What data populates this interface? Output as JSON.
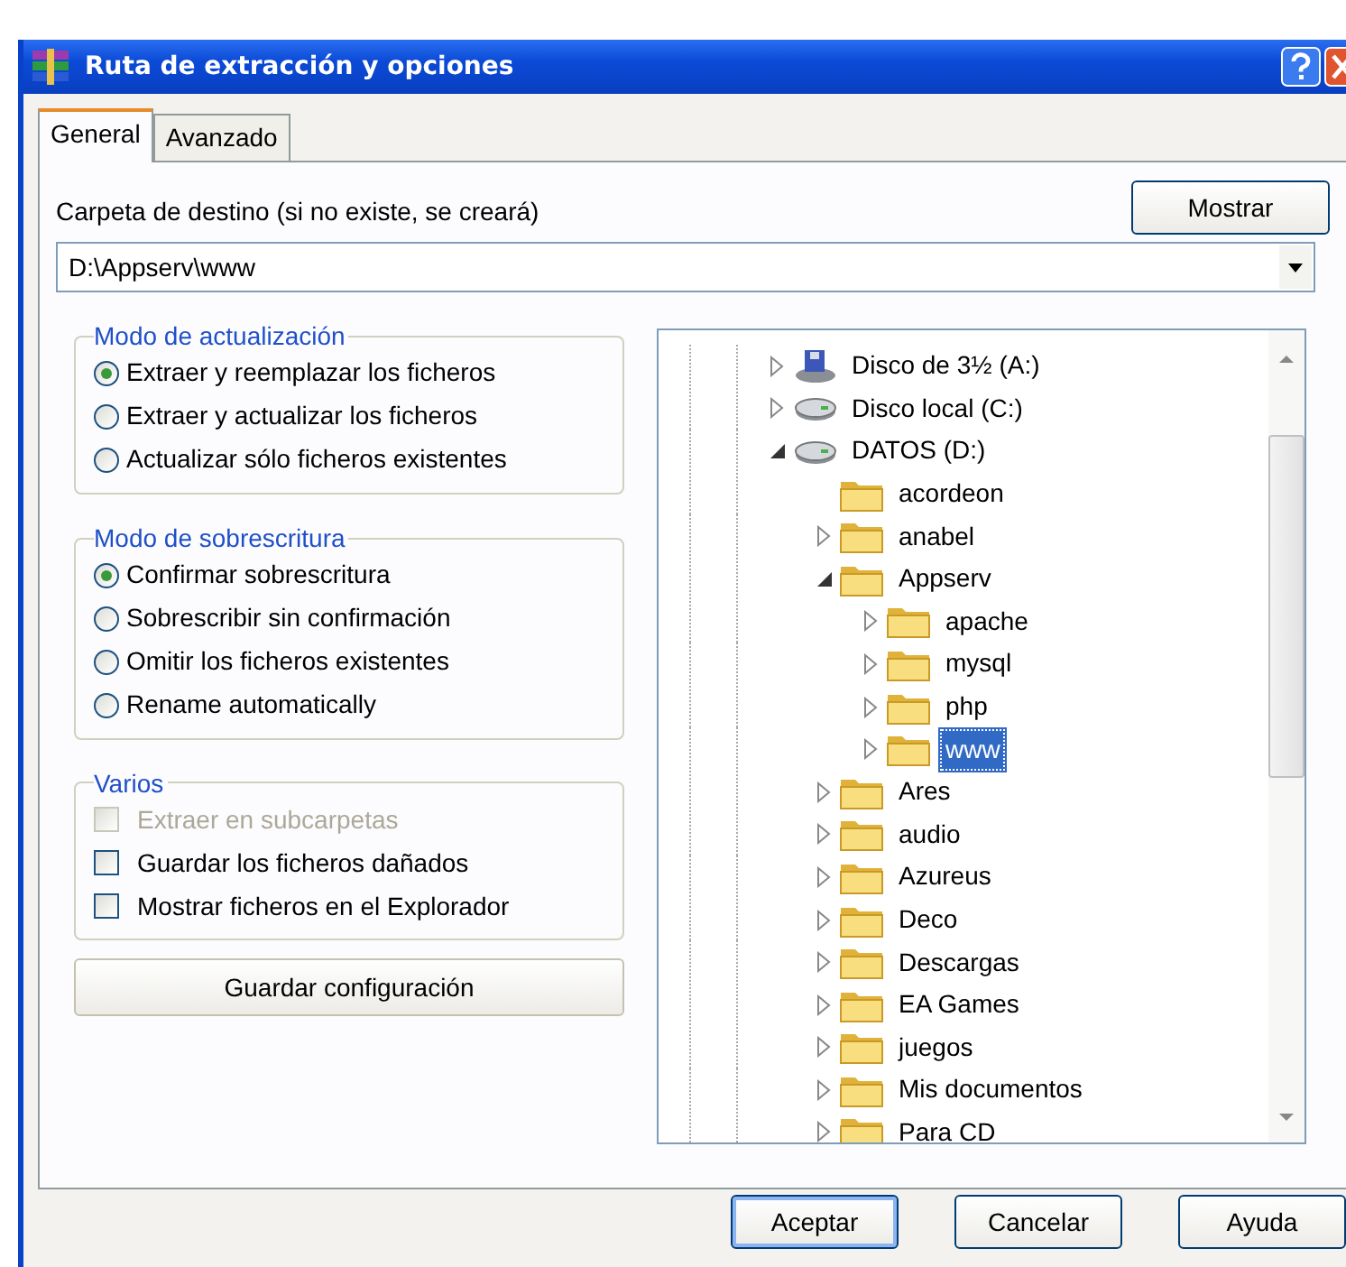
{
  "window": {
    "title": "Ruta de extracción y opciones"
  },
  "tabs": [
    {
      "label": "General",
      "selected": true
    },
    {
      "label": "Avanzado",
      "selected": false
    }
  ],
  "destination": {
    "label": "Carpeta de destino (si no existe, se creará)",
    "button": "Mostrar",
    "value": "D:\\Appserv\\www"
  },
  "update_mode": {
    "title": "Modo de actualización",
    "options": [
      {
        "label": "Extraer y reemplazar los ficheros",
        "selected": true
      },
      {
        "label": "Extraer y actualizar los ficheros",
        "selected": false
      },
      {
        "label": "Actualizar sólo ficheros existentes",
        "selected": false
      }
    ]
  },
  "overwrite_mode": {
    "title": "Modo de sobrescritura",
    "options": [
      {
        "label": "Confirmar sobrescritura",
        "selected": true
      },
      {
        "label": "Sobrescribir sin confirmación",
        "selected": false
      },
      {
        "label": "Omitir los ficheros existentes",
        "selected": false
      },
      {
        "label": "Rename automatically",
        "selected": false
      }
    ]
  },
  "misc": {
    "title": "Varios",
    "options": [
      {
        "label": "Extraer en subcarpetas",
        "checked": false,
        "disabled": true
      },
      {
        "label": "Guardar los ficheros dañados",
        "checked": false,
        "disabled": false
      },
      {
        "label": "Mostrar ficheros en el Explorador",
        "checked": false,
        "disabled": false
      }
    ]
  },
  "save_button": "Guardar configuración",
  "tree": [
    {
      "label": "Disco de 3½ (A:)",
      "kind": "floppy",
      "expanded": false,
      "selected": false
    },
    {
      "label": "Disco local (C:)",
      "kind": "drive",
      "expanded": false,
      "selected": false
    },
    {
      "label": "DATOS (D:)",
      "kind": "drive",
      "expanded": true,
      "selected": false,
      "children": [
        {
          "label": "acordeon",
          "kind": "folder",
          "selected": false
        },
        {
          "label": "anabel",
          "kind": "folder",
          "expanded": false,
          "selected": false
        },
        {
          "label": "Appserv",
          "kind": "folder",
          "expanded": true,
          "selected": false,
          "children": [
            {
              "label": "apache",
              "kind": "folder",
              "expanded": false,
              "selected": false
            },
            {
              "label": "mysql",
              "kind": "folder",
              "expanded": false,
              "selected": false
            },
            {
              "label": "php",
              "kind": "folder",
              "expanded": false,
              "selected": false
            },
            {
              "label": "www",
              "kind": "folder",
              "expanded": false,
              "selected": true
            }
          ]
        },
        {
          "label": "Ares",
          "kind": "folder",
          "expanded": false,
          "selected": false
        },
        {
          "label": "audio",
          "kind": "folder",
          "expanded": false,
          "selected": false
        },
        {
          "label": "Azureus",
          "kind": "folder",
          "expanded": false,
          "selected": false
        },
        {
          "label": "Deco",
          "kind": "folder",
          "expanded": false,
          "selected": false
        },
        {
          "label": "Descargas",
          "kind": "folder",
          "expanded": false,
          "selected": false
        },
        {
          "label": "EA Games",
          "kind": "folder",
          "expanded": false,
          "selected": false
        },
        {
          "label": "juegos",
          "kind": "folder",
          "expanded": false,
          "selected": false
        },
        {
          "label": "Mis documentos",
          "kind": "folder",
          "expanded": false,
          "selected": false
        },
        {
          "label": "Para CD",
          "kind": "folder",
          "expanded": false,
          "selected": false
        }
      ]
    }
  ],
  "buttons": [
    {
      "label": "Aceptar",
      "default": true
    },
    {
      "label": "Cancelar",
      "default": false
    },
    {
      "label": "Ayuda",
      "default": false
    }
  ]
}
